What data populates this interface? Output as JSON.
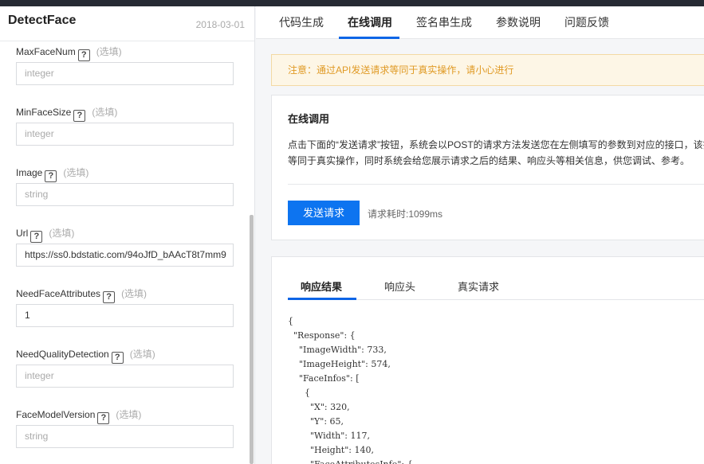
{
  "api": {
    "name": "DetectFace",
    "date": "2018-03-01"
  },
  "params": [
    {
      "name": "MaxFaceNum",
      "optional": "(选填)",
      "value": "",
      "placeholder": "integer"
    },
    {
      "name": "MinFaceSize",
      "optional": "(选填)",
      "value": "",
      "placeholder": "integer"
    },
    {
      "name": "Image",
      "optional": "(选填)",
      "value": "",
      "placeholder": "string"
    },
    {
      "name": "Url",
      "optional": "(选填)",
      "value": "https://ss0.bdstatic.com/94oJfD_bAAcT8t7mm9",
      "placeholder": "string"
    },
    {
      "name": "NeedFaceAttributes",
      "optional": "(选填)",
      "value": "1",
      "placeholder": "integer"
    },
    {
      "name": "NeedQualityDetection",
      "optional": "(选填)",
      "value": "",
      "placeholder": "integer"
    },
    {
      "name": "FaceModelVersion",
      "optional": "(选填)",
      "value": "",
      "placeholder": "string"
    }
  ],
  "help_glyph": "?",
  "tabs": [
    "代码生成",
    "在线调用",
    "签名串生成",
    "参数说明",
    "问题反馈"
  ],
  "active_tab": "在线调用",
  "notice": "注意：通过API发送请求等同于真实操作，请小心进行",
  "online": {
    "title": "在线调用",
    "desc_line1": "点击下面的“发送请求”按钮，系统会以POST的请求方法发送您在左侧填写的参数到对应的接口，该操",
    "desc_line2": "等同于真实操作，同时系统会给您展示请求之后的结果、响应头等相关信息，供您调试、参考。",
    "send_label": "发送请求",
    "elapsed": "请求耗时:1099ms"
  },
  "result_tabs": [
    "响应结果",
    "响应头",
    "真实请求"
  ],
  "response_lines": [
    "{",
    "  \"Response\": {",
    "    \"ImageWidth\": 733,",
    "    \"ImageHeight\": 574,",
    "    \"FaceInfos\": [",
    "      {",
    "        \"X\": 320,",
    "        \"Y\": 65,",
    "        \"Width\": 117,",
    "        \"Height\": 140,",
    "        \"FaceAttributesInfo\": {"
  ],
  "colors": {
    "primary": "#0d74f0",
    "notice_bg": "#fdf6e6",
    "notice_text": "#e09a25"
  }
}
